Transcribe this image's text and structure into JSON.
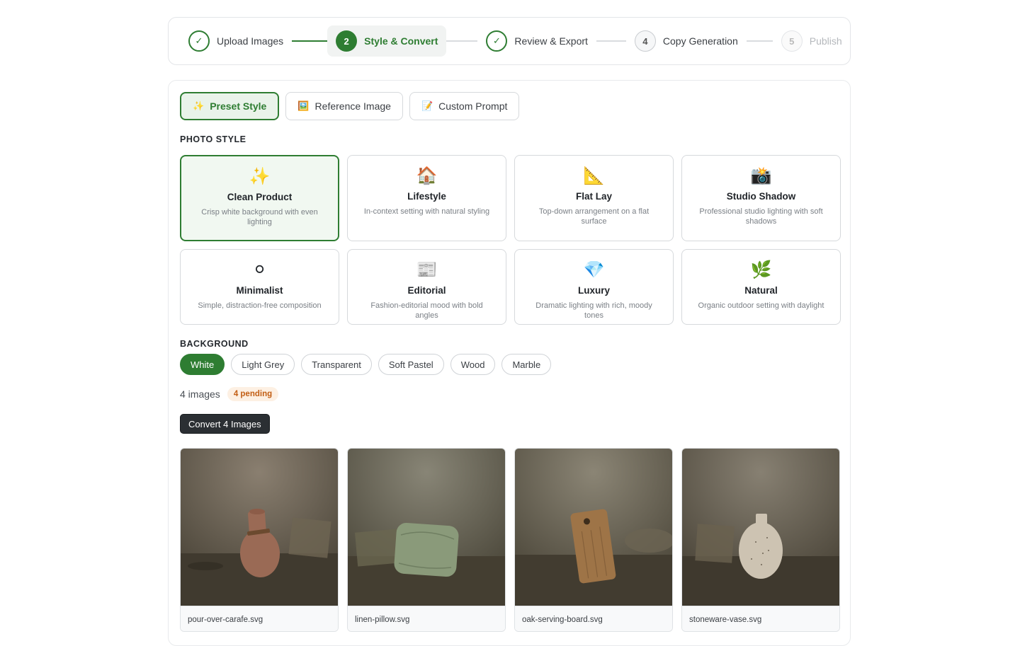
{
  "stepper": {
    "steps": [
      {
        "number": "1",
        "label": "Upload Images",
        "state": "done"
      },
      {
        "number": "2",
        "label": "Style & Convert",
        "state": "current"
      },
      {
        "number": "3",
        "label": "Review & Export",
        "state": "done"
      },
      {
        "number": "4",
        "label": "Copy Generation",
        "state": "todo"
      },
      {
        "number": "5",
        "label": "Publish",
        "state": "disabled"
      }
    ],
    "check_glyph": "✓"
  },
  "tabs": [
    {
      "icon": "✨",
      "label": "Preset Style",
      "active": true
    },
    {
      "icon": "🖼️",
      "label": "Reference Image",
      "active": false
    },
    {
      "icon": "📝",
      "label": "Custom Prompt",
      "active": false
    }
  ],
  "photo_style": {
    "heading": "PHOTO STYLE",
    "styles": [
      {
        "icon": "✨",
        "name": "Clean Product",
        "description": "Crisp white background with even lighting",
        "selected": true
      },
      {
        "icon": "🏠",
        "name": "Lifestyle",
        "description": "In-context setting with natural styling",
        "selected": false
      },
      {
        "icon": "📐",
        "name": "Flat Lay",
        "description": "Top-down arrangement on a flat surface",
        "selected": false
      },
      {
        "icon": "📸",
        "name": "Studio Shadow",
        "description": "Professional studio lighting with soft shadows",
        "selected": false
      },
      {
        "icon": "⚪",
        "name": "Minimalist",
        "description": "Simple, distraction-free composition",
        "selected": false
      },
      {
        "icon": "📰",
        "name": "Editorial",
        "description": "Fashion-editorial mood with bold angles",
        "selected": false
      },
      {
        "icon": "💎",
        "name": "Luxury",
        "description": "Dramatic lighting with rich, moody tones",
        "selected": false
      },
      {
        "icon": "🌿",
        "name": "Natural",
        "description": "Organic outdoor setting with daylight",
        "selected": false
      }
    ]
  },
  "background": {
    "heading": "BACKGROUND",
    "options": [
      {
        "label": "White",
        "selected": true
      },
      {
        "label": "Light Grey",
        "selected": false
      },
      {
        "label": "Transparent",
        "selected": false
      },
      {
        "label": "Soft Pastel",
        "selected": false
      },
      {
        "label": "Wood",
        "selected": false
      },
      {
        "label": "Marble",
        "selected": false
      }
    ]
  },
  "summary": {
    "count_text": "4 images",
    "pending_badge": "4 pending"
  },
  "convert_button": "Convert 4 Images",
  "images": [
    {
      "filename": "pour-over-carafe.svg",
      "subject": "carafe",
      "object_color": "#9a6a55"
    },
    {
      "filename": "linen-pillow.svg",
      "subject": "pillow",
      "object_color": "#8a9a7a"
    },
    {
      "filename": "oak-serving-board.svg",
      "subject": "board",
      "object_color": "#9e7447"
    },
    {
      "filename": "stoneware-vase.svg",
      "subject": "vase",
      "object_color": "#cdc3b2"
    }
  ],
  "colors": {
    "accent": "#2e7d32",
    "accent_light": "#e9f3ea",
    "pending_bg": "#fdf0e3",
    "pending_text": "#c25e14",
    "button_dark": "#2b2f33"
  }
}
